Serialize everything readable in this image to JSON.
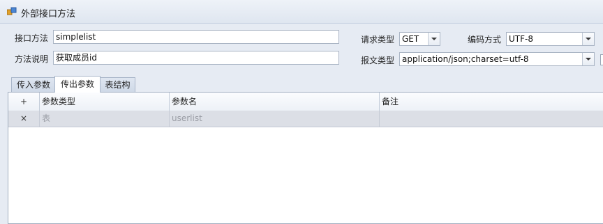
{
  "window": {
    "title": "外部接口方法",
    "icon": "app-window-icon"
  },
  "form": {
    "method_name": {
      "label": "接口方法",
      "value": "simplelist"
    },
    "method_desc": {
      "label": "方法说明",
      "value": "获取成员id"
    },
    "request_type": {
      "label": "请求类型",
      "value": "GET"
    },
    "encoding": {
      "label": "编码方式",
      "value": "UTF-8"
    },
    "content_type": {
      "label": "报文类型",
      "value": "application/json;charset=utf-8"
    }
  },
  "tabs": [
    {
      "label": "传入参数",
      "active": false
    },
    {
      "label": "传出参数",
      "active": true
    },
    {
      "label": "表结构",
      "active": false
    }
  ],
  "grid": {
    "add_glyph": "+",
    "columns": [
      "参数类型",
      "参数名",
      "备注"
    ],
    "rows": [
      {
        "delete_glyph": "×",
        "param_type": "表",
        "param_name": "userlist",
        "note": ""
      }
    ]
  },
  "colors": {
    "window_bg": "#e6ebf3",
    "border": "#a9b4c4",
    "row_bg": "#dcdfe6"
  }
}
